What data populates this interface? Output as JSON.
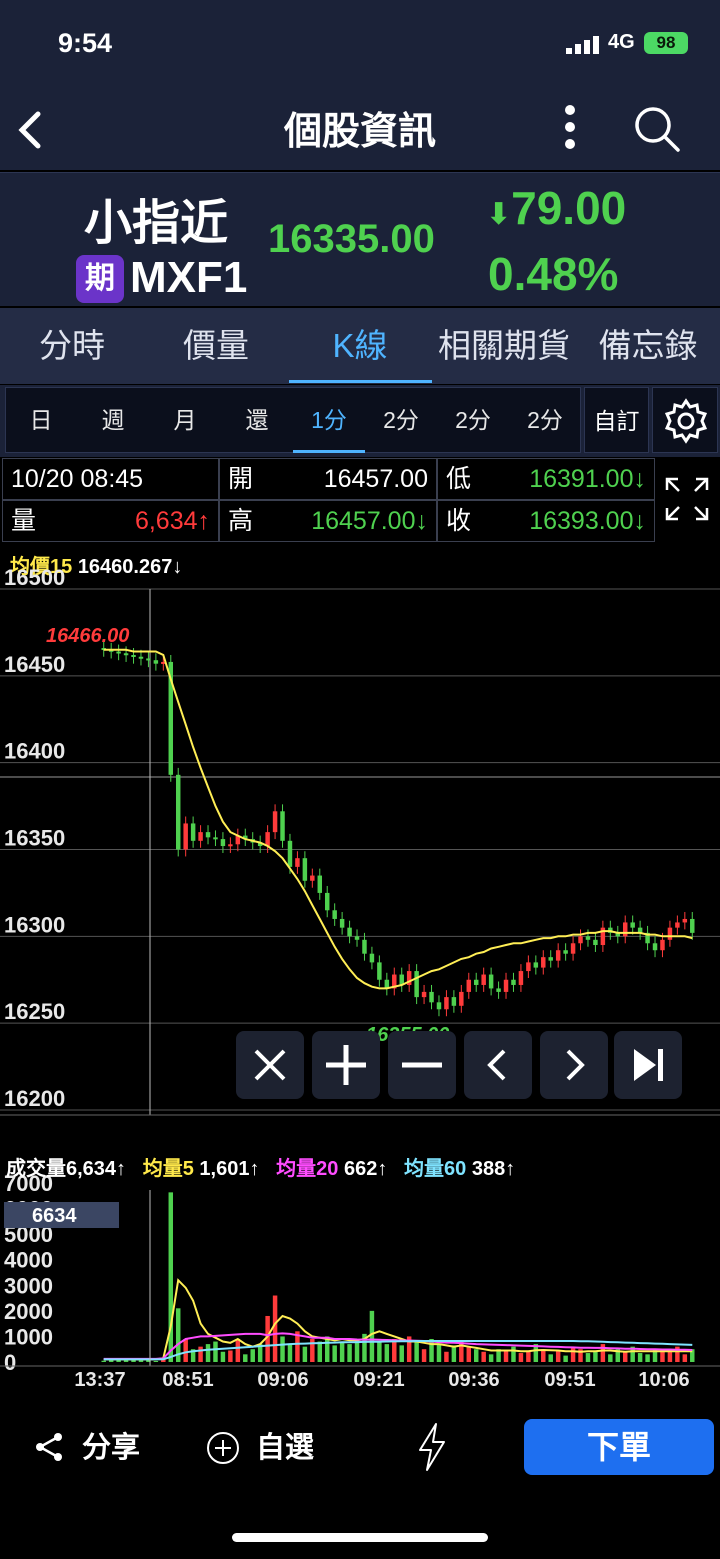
{
  "status_bar": {
    "time": "9:54",
    "network": "4G",
    "battery": "98"
  },
  "header": {
    "title": "個股資訊"
  },
  "quote": {
    "name": "小指近",
    "badge": "期",
    "code": "MXF1",
    "price": "16335.00",
    "change": "79.00",
    "change_pct": "0.48%",
    "colors": {
      "down": "#4fd14f",
      "up": "#ff3b3b",
      "accent": "#4fb4ff"
    }
  },
  "tabs": [
    {
      "label": "分時"
    },
    {
      "label": "價量"
    },
    {
      "label": "K線",
      "active": true
    },
    {
      "label": "相關期貨"
    },
    {
      "label": "備忘錄"
    }
  ],
  "periods": [
    {
      "label": "日"
    },
    {
      "label": "週"
    },
    {
      "label": "月"
    },
    {
      "label": "還"
    },
    {
      "label": "1分",
      "active": true
    },
    {
      "label": "2分"
    },
    {
      "label": "2分"
    },
    {
      "label": "2分"
    }
  ],
  "period_custom": "自訂",
  "ohlc": {
    "time": "10/20 08:45",
    "open_label": "開",
    "open": "16457.00",
    "low_label": "低",
    "low": "16391.00↓",
    "vol_label": "量",
    "volume": "6,634↑",
    "high_label": "高",
    "high": "16457.00↓",
    "close_label": "收",
    "close": "16393.00↓"
  },
  "price_legend": {
    "label": "均價",
    "period": "15",
    "value": "16460.267↓"
  },
  "volume_legend": {
    "vol_label": "成交量",
    "vol": "6,634↑",
    "ma5_label": "均量",
    "ma5_period": "5",
    "ma5": "1,601↑",
    "ma20_label": "均量",
    "ma20_period": "20",
    "ma20": "662↑",
    "ma60_label": "均量",
    "ma60_period": "60",
    "ma60": "388↑"
  },
  "chart_data": {
    "type": "candlestick",
    "price_axis": {
      "ticks": [
        "16500",
        "16450",
        "16400",
        "16350",
        "16300",
        "16250",
        "16200"
      ],
      "ylim": [
        16200,
        16500
      ]
    },
    "volume_axis": {
      "ticks": [
        "7000",
        "6000",
        "5000",
        "4000",
        "3000",
        "2000",
        "1000",
        "0"
      ],
      "ylim": [
        0,
        7000
      ]
    },
    "x_ticks": [
      "13:37",
      "08:51",
      "09:06",
      "09:21",
      "09:36",
      "09:51",
      "10:06"
    ],
    "max_label": "16466.00",
    "min_label": "16255.00",
    "crosshair_volume": "6634",
    "closes": [
      16465,
      16464,
      16463,
      16462,
      16461,
      16460,
      16459,
      16457,
      16458,
      16393,
      16350,
      16365,
      16355,
      16360,
      16357,
      16356,
      16352,
      16353,
      16358,
      16356,
      16354,
      16352,
      16360,
      16372,
      16355,
      16340,
      16345,
      16332,
      16335,
      16325,
      16315,
      16310,
      16305,
      16300,
      16298,
      16290,
      16285,
      16275,
      16270,
      16278,
      16272,
      16280,
      16265,
      16268,
      16262,
      16258,
      16265,
      16260,
      16268,
      16275,
      16272,
      16278,
      16270,
      16268,
      16275,
      16272,
      16280,
      16285,
      16282,
      16288,
      16286,
      16292,
      16290,
      16296,
      16300,
      16298,
      16295,
      16305,
      16302,
      16300,
      16308,
      16305,
      16302,
      16296,
      16292,
      16298,
      16305,
      16308,
      16310,
      16302
    ],
    "ma15": [
      16465,
      16465,
      16465,
      16465,
      16464,
      16464,
      16464,
      16464,
      16462,
      16448,
      16435,
      16422,
      16409,
      16397,
      16386,
      16375,
      16366,
      16360,
      16358,
      16356,
      16355,
      16354,
      16352,
      16349,
      16345,
      16339,
      16333,
      16326,
      16318,
      16310,
      16302,
      16294,
      16287,
      16281,
      16276,
      16273,
      16271,
      16270,
      16270,
      16271,
      16272,
      16274,
      16276,
      16278,
      16280,
      16281,
      16283,
      16285,
      16287,
      16288,
      16290,
      16291,
      16293,
      16294,
      16295,
      16296,
      16296,
      16297,
      16298,
      16299,
      16299,
      16300,
      16300,
      16301,
      16301,
      16302,
      16302,
      16303,
      16303,
      16302,
      16302,
      16302,
      16302,
      16301,
      16301,
      16300,
      16300,
      16300,
      16300,
      16299
    ],
    "volumes": [
      50,
      120,
      80,
      60,
      90,
      60,
      110,
      40,
      100,
      6634,
      2100,
      900,
      500,
      600,
      700,
      800,
      400,
      450,
      900,
      300,
      500,
      700,
      1800,
      2600,
      1000,
      700,
      1200,
      600,
      900,
      800,
      1000,
      650,
      800,
      700,
      900,
      1100,
      2000,
      800,
      700,
      900,
      650,
      1000,
      800,
      500,
      900,
      700,
      400,
      650,
      800,
      600,
      500,
      400,
      300,
      500,
      450,
      600,
      350,
      400,
      700,
      500,
      300,
      450,
      250,
      600,
      500,
      350,
      400,
      700,
      300,
      500,
      400,
      600,
      350,
      300,
      500,
      450,
      400,
      600,
      300,
      500
    ],
    "vma5": [
      100,
      100,
      100,
      100,
      100,
      100,
      100,
      100,
      150,
      1400,
      3200,
      2900,
      2400,
      1500,
      1100,
      950,
      800,
      750,
      900,
      700,
      600,
      700,
      1000,
      1500,
      1800,
      1700,
      1500,
      1200,
      1000,
      950,
      900,
      850,
      900,
      850,
      850,
      900,
      1100,
      1200,
      1100,
      1000,
      900,
      800,
      800,
      750,
      700,
      700,
      650,
      600,
      650,
      600,
      550,
      500,
      450,
      450,
      450,
      450,
      420,
      420,
      460,
      470,
      460,
      450,
      420,
      420,
      400,
      420,
      420,
      450,
      450,
      420,
      400,
      420,
      420,
      420,
      420,
      420,
      420,
      420,
      420,
      420
    ],
    "vma20": [
      120,
      120,
      120,
      120,
      120,
      120,
      120,
      120,
      140,
      450,
      700,
      900,
      950,
      1000,
      1000,
      1020,
      1040,
      1060,
      1080,
      1100,
      1100,
      1100,
      1050,
      1100,
      1120,
      1100,
      1050,
      1000,
      950,
      950,
      950,
      900,
      900,
      900,
      880,
      870,
      880,
      870,
      860,
      850,
      840,
      840,
      830,
      820,
      800,
      780,
      760,
      750,
      740,
      720,
      700,
      690,
      680,
      670,
      660,
      650,
      640,
      630,
      620,
      610,
      600,
      590,
      580,
      570,
      560,
      560,
      550,
      550,
      540,
      530,
      520,
      520,
      510,
      500,
      500,
      490,
      490,
      480,
      480,
      470
    ],
    "vma60": [
      100,
      100,
      100,
      100,
      100,
      100,
      100,
      100,
      110,
      200,
      300,
      380,
      420,
      450,
      480,
      500,
      520,
      540,
      560,
      580,
      600,
      620,
      640,
      660,
      680,
      700,
      710,
      720,
      730,
      740,
      750,
      760,
      770,
      775,
      780,
      785,
      790,
      795,
      800,
      805,
      810,
      815,
      820,
      820,
      820,
      820,
      820,
      820,
      820,
      820,
      820,
      820,
      820,
      820,
      820,
      820,
      820,
      820,
      820,
      820,
      820,
      820,
      820,
      820,
      815,
      810,
      800,
      790,
      780,
      770,
      760,
      750,
      740,
      730,
      720,
      710,
      700,
      690,
      680,
      670
    ]
  }
}
